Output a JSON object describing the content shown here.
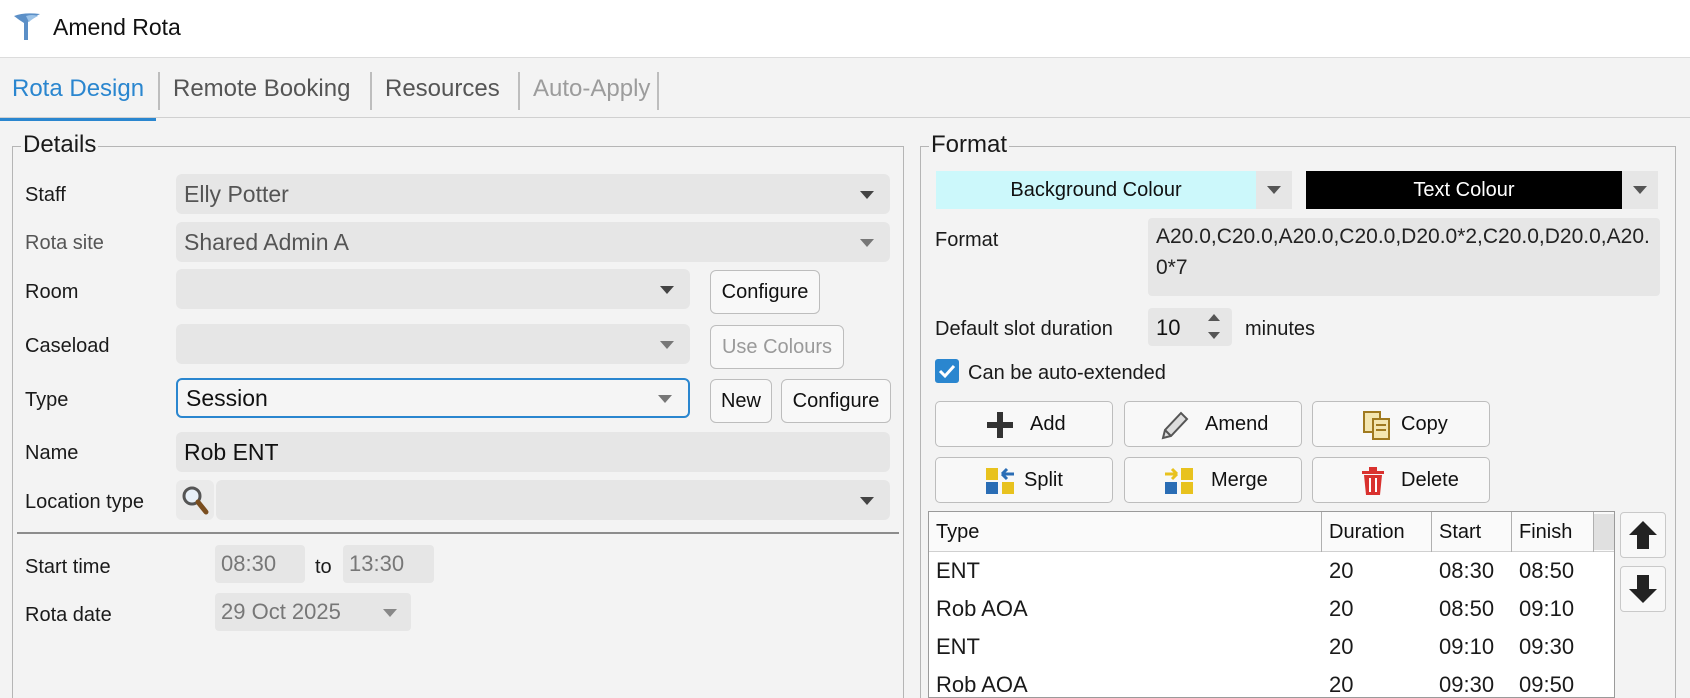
{
  "window": {
    "title": "Amend Rota"
  },
  "tabs": [
    {
      "label": "Rota Design",
      "state": "active"
    },
    {
      "label": "Remote Booking",
      "state": "normal"
    },
    {
      "label": "Resources",
      "state": "normal"
    },
    {
      "label": "Auto-Apply",
      "state": "disabled"
    }
  ],
  "details": {
    "legend": "Details",
    "staff": {
      "label": "Staff",
      "value": "Elly Potter"
    },
    "rota_site": {
      "label": "Rota site",
      "value": "Shared Admin A"
    },
    "room": {
      "label": "Room",
      "value": "",
      "configure_label": "Configure"
    },
    "caseload": {
      "label": "Caseload",
      "value": "",
      "use_colours_label": "Use Colours"
    },
    "type": {
      "label": "Type",
      "value": "Session",
      "new_label": "New",
      "configure_label": "Configure"
    },
    "name": {
      "label": "Name",
      "value": "Rob ENT"
    },
    "location_type": {
      "label": "Location type",
      "value": ""
    },
    "start_time": {
      "label": "Start time",
      "from": "08:30",
      "to_label": "to",
      "to": "13:30"
    },
    "rota_date": {
      "label": "Rota date",
      "value": "29 Oct 2025"
    }
  },
  "format": {
    "legend": "Format",
    "background_colour": {
      "label": "Background Colour",
      "color": "#ccf8fb"
    },
    "text_colour": {
      "label": "Text Colour",
      "color": "#000000"
    },
    "format_label": "Format",
    "format_value": "A20.0,C20.0,A20.0,C20.0,D20.0*2,C20.0,D20.0,A20.0*7",
    "default_slot": {
      "label": "Default slot duration",
      "value": "10",
      "unit": "minutes"
    },
    "auto_extend": {
      "label": "Can be auto-extended",
      "checked": true
    },
    "buttons": {
      "add": "Add",
      "amend": "Amend",
      "copy": "Copy",
      "split": "Split",
      "merge": "Merge",
      "delete": "Delete"
    },
    "grid": {
      "columns": [
        "Type",
        "Duration",
        "Start",
        "Finish"
      ],
      "rows": [
        {
          "type": "ENT",
          "duration": "20",
          "start": "08:30",
          "finish": "08:50"
        },
        {
          "type": "Rob AOA",
          "duration": "20",
          "start": "08:50",
          "finish": "09:10"
        },
        {
          "type": "ENT",
          "duration": "20",
          "start": "09:10",
          "finish": "09:30"
        },
        {
          "type": "Rob AOA",
          "duration": "20",
          "start": "09:30",
          "finish": "09:50"
        }
      ]
    }
  },
  "colors": {
    "accent": "#2a86cf",
    "checkbox": "#2a86cf",
    "delete_red": "#d9322f",
    "icon_yellow": "#e8c21e",
    "icon_blue": "#2a6db5"
  }
}
